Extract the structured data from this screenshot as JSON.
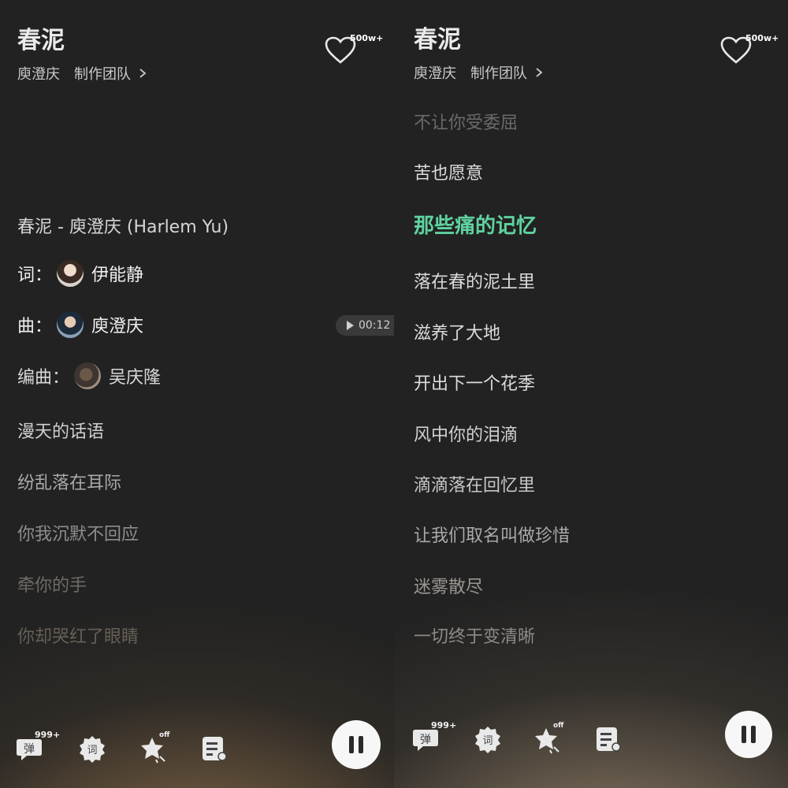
{
  "left": {
    "song_title": "春泥",
    "artist": "庾澄庆",
    "team": "制作团队",
    "like_count": "500w+",
    "lyrics": [
      {
        "text": "春泥 - 庾澄庆 (Harlem Yu)",
        "color": "#d6d6d6"
      },
      {
        "credit_label": "词：",
        "name": "伊能静",
        "color": "#efefef"
      },
      {
        "credit_label": "曲：",
        "name": "庾澄庆",
        "color": "#efefef"
      },
      {
        "credit_label": "编曲：",
        "name": "吴庆隆",
        "color": "#d8d8d8"
      },
      {
        "text": "漫天的话语",
        "color": "#cfcfcf"
      },
      {
        "text": "纷乱落在耳际",
        "color": "#a9a9a9"
      },
      {
        "text": "你我沉默不回应",
        "color": "#8d8d8d"
      },
      {
        "text": "牵你的手",
        "color": "#6e6a66"
      },
      {
        "text": "你却哭红了眼睛",
        "color": "#665f57"
      }
    ],
    "time_badge": "00:12",
    "icons": {
      "danmu_label": "弹",
      "danmu_count": "999+",
      "lyric_label": "词",
      "fx_state": "off"
    }
  },
  "right": {
    "song_title": "春泥",
    "artist": "庾澄庆",
    "team": "制作团队",
    "like_count": "500w+",
    "lyrics": [
      {
        "text": "不让你受委屈",
        "color": "#6a6a6a"
      },
      {
        "text": "苦也愿意",
        "color": "#dcdcdc"
      },
      {
        "text": "那些痛的记忆",
        "color": "#5fd2a0",
        "active": true
      },
      {
        "text": "落在春的泥土里",
        "color": "#dcdcdc"
      },
      {
        "text": "滋养了大地",
        "color": "#dcdcdc"
      },
      {
        "text": "开出下一个花季",
        "color": "#dcdcdc"
      },
      {
        "text": "风中你的泪滴",
        "color": "#d2d2d2"
      },
      {
        "text": "滴滴落在回忆里",
        "color": "#c8c8c8"
      },
      {
        "text": "让我们取名叫做珍惜",
        "color": "#a9a9a9"
      },
      {
        "text": "迷雾散尽",
        "color": "#9a9690"
      },
      {
        "text": "一切终于变清晰",
        "color": "#8e8a85"
      }
    ],
    "icons": {
      "danmu_label": "弹",
      "danmu_count": "999+",
      "lyric_label": "词",
      "fx_state": "off"
    }
  },
  "colors": {
    "accent_green": "#5fd2a0"
  }
}
